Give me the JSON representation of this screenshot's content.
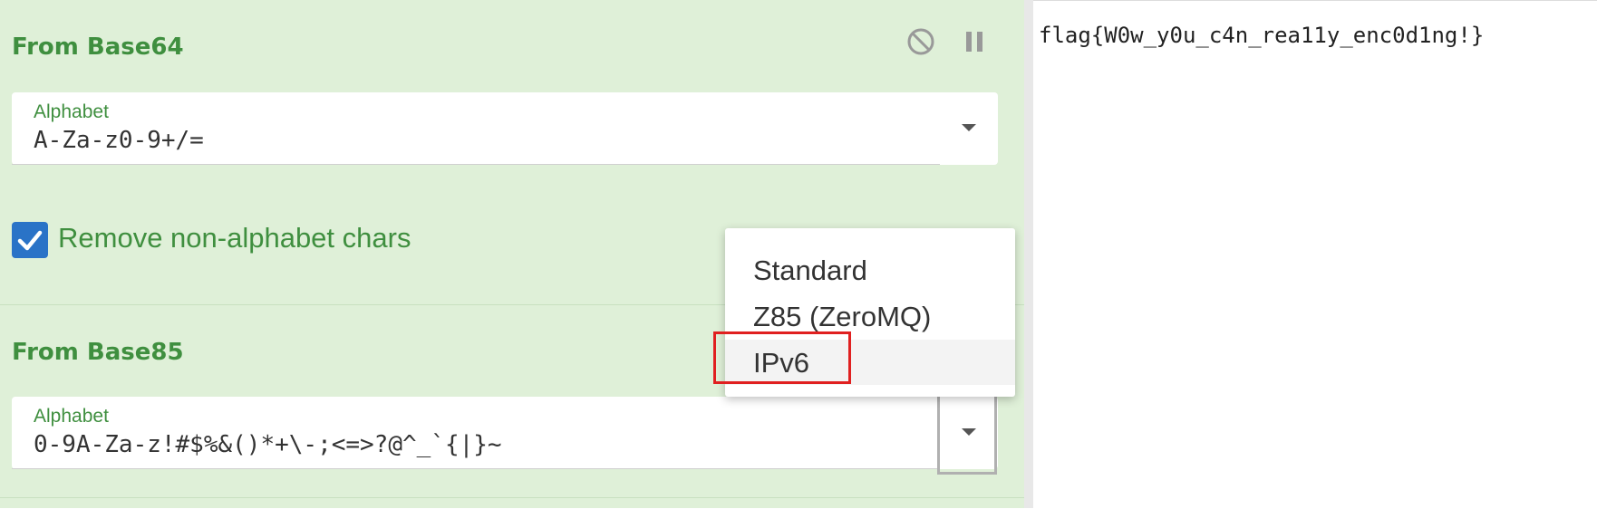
{
  "operations": [
    {
      "title": "From Base64",
      "alphabet_label": "Alphabet",
      "alphabet_value": "A-Za-z0-9+/=",
      "checkbox_label": "Remove non-alphabet chars",
      "checkbox_checked": true,
      "controls": {
        "disable_icon": "ban-icon",
        "pause_icon": "pause-icon"
      }
    },
    {
      "title": "From Base85",
      "alphabet_label": "Alphabet",
      "alphabet_value": "0-9A-Za-z!#$%&()*+\\-;<=>?@^_`{|}~"
    }
  ],
  "dropdown_menu": {
    "items": [
      "Standard",
      "Z85 (ZeroMQ)",
      "IPv6"
    ],
    "highlighted_item": "IPv6"
  },
  "output": {
    "text": "flag{W0w_y0u_c4n_rea11y_enc0d1ng!}"
  },
  "colors": {
    "recipe_bg": "#dff0d8",
    "title_green": "#3f8f3f",
    "checkbox_blue": "#2a73c7",
    "highlight_red": "#e02020"
  }
}
